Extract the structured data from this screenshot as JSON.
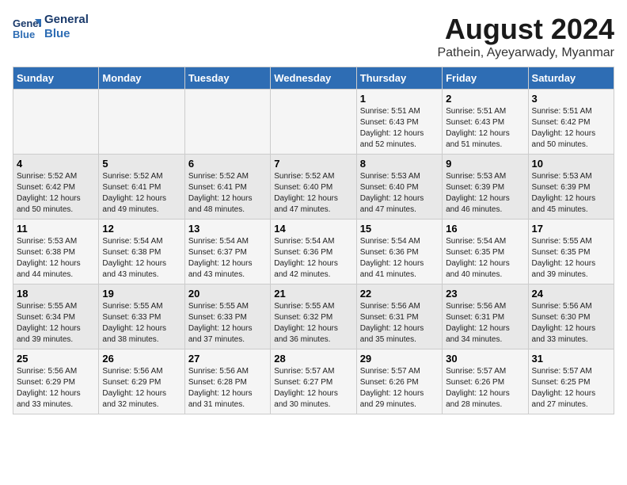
{
  "logo": {
    "line1": "General",
    "line2": "Blue"
  },
  "title": "August 2024",
  "subtitle": "Pathein, Ayeyarwady, Myanmar",
  "days_of_week": [
    "Sunday",
    "Monday",
    "Tuesday",
    "Wednesday",
    "Thursday",
    "Friday",
    "Saturday"
  ],
  "weeks": [
    [
      {
        "day": "",
        "info": ""
      },
      {
        "day": "",
        "info": ""
      },
      {
        "day": "",
        "info": ""
      },
      {
        "day": "",
        "info": ""
      },
      {
        "day": "1",
        "info": "Sunrise: 5:51 AM\nSunset: 6:43 PM\nDaylight: 12 hours\nand 52 minutes."
      },
      {
        "day": "2",
        "info": "Sunrise: 5:51 AM\nSunset: 6:43 PM\nDaylight: 12 hours\nand 51 minutes."
      },
      {
        "day": "3",
        "info": "Sunrise: 5:51 AM\nSunset: 6:42 PM\nDaylight: 12 hours\nand 50 minutes."
      }
    ],
    [
      {
        "day": "4",
        "info": "Sunrise: 5:52 AM\nSunset: 6:42 PM\nDaylight: 12 hours\nand 50 minutes."
      },
      {
        "day": "5",
        "info": "Sunrise: 5:52 AM\nSunset: 6:41 PM\nDaylight: 12 hours\nand 49 minutes."
      },
      {
        "day": "6",
        "info": "Sunrise: 5:52 AM\nSunset: 6:41 PM\nDaylight: 12 hours\nand 48 minutes."
      },
      {
        "day": "7",
        "info": "Sunrise: 5:52 AM\nSunset: 6:40 PM\nDaylight: 12 hours\nand 47 minutes."
      },
      {
        "day": "8",
        "info": "Sunrise: 5:53 AM\nSunset: 6:40 PM\nDaylight: 12 hours\nand 47 minutes."
      },
      {
        "day": "9",
        "info": "Sunrise: 5:53 AM\nSunset: 6:39 PM\nDaylight: 12 hours\nand 46 minutes."
      },
      {
        "day": "10",
        "info": "Sunrise: 5:53 AM\nSunset: 6:39 PM\nDaylight: 12 hours\nand 45 minutes."
      }
    ],
    [
      {
        "day": "11",
        "info": "Sunrise: 5:53 AM\nSunset: 6:38 PM\nDaylight: 12 hours\nand 44 minutes."
      },
      {
        "day": "12",
        "info": "Sunrise: 5:54 AM\nSunset: 6:38 PM\nDaylight: 12 hours\nand 43 minutes."
      },
      {
        "day": "13",
        "info": "Sunrise: 5:54 AM\nSunset: 6:37 PM\nDaylight: 12 hours\nand 43 minutes."
      },
      {
        "day": "14",
        "info": "Sunrise: 5:54 AM\nSunset: 6:36 PM\nDaylight: 12 hours\nand 42 minutes."
      },
      {
        "day": "15",
        "info": "Sunrise: 5:54 AM\nSunset: 6:36 PM\nDaylight: 12 hours\nand 41 minutes."
      },
      {
        "day": "16",
        "info": "Sunrise: 5:54 AM\nSunset: 6:35 PM\nDaylight: 12 hours\nand 40 minutes."
      },
      {
        "day": "17",
        "info": "Sunrise: 5:55 AM\nSunset: 6:35 PM\nDaylight: 12 hours\nand 39 minutes."
      }
    ],
    [
      {
        "day": "18",
        "info": "Sunrise: 5:55 AM\nSunset: 6:34 PM\nDaylight: 12 hours\nand 39 minutes."
      },
      {
        "day": "19",
        "info": "Sunrise: 5:55 AM\nSunset: 6:33 PM\nDaylight: 12 hours\nand 38 minutes."
      },
      {
        "day": "20",
        "info": "Sunrise: 5:55 AM\nSunset: 6:33 PM\nDaylight: 12 hours\nand 37 minutes."
      },
      {
        "day": "21",
        "info": "Sunrise: 5:55 AM\nSunset: 6:32 PM\nDaylight: 12 hours\nand 36 minutes."
      },
      {
        "day": "22",
        "info": "Sunrise: 5:56 AM\nSunset: 6:31 PM\nDaylight: 12 hours\nand 35 minutes."
      },
      {
        "day": "23",
        "info": "Sunrise: 5:56 AM\nSunset: 6:31 PM\nDaylight: 12 hours\nand 34 minutes."
      },
      {
        "day": "24",
        "info": "Sunrise: 5:56 AM\nSunset: 6:30 PM\nDaylight: 12 hours\nand 33 minutes."
      }
    ],
    [
      {
        "day": "25",
        "info": "Sunrise: 5:56 AM\nSunset: 6:29 PM\nDaylight: 12 hours\nand 33 minutes."
      },
      {
        "day": "26",
        "info": "Sunrise: 5:56 AM\nSunset: 6:29 PM\nDaylight: 12 hours\nand 32 minutes."
      },
      {
        "day": "27",
        "info": "Sunrise: 5:56 AM\nSunset: 6:28 PM\nDaylight: 12 hours\nand 31 minutes."
      },
      {
        "day": "28",
        "info": "Sunrise: 5:57 AM\nSunset: 6:27 PM\nDaylight: 12 hours\nand 30 minutes."
      },
      {
        "day": "29",
        "info": "Sunrise: 5:57 AM\nSunset: 6:26 PM\nDaylight: 12 hours\nand 29 minutes."
      },
      {
        "day": "30",
        "info": "Sunrise: 5:57 AM\nSunset: 6:26 PM\nDaylight: 12 hours\nand 28 minutes."
      },
      {
        "day": "31",
        "info": "Sunrise: 5:57 AM\nSunset: 6:25 PM\nDaylight: 12 hours\nand 27 minutes."
      }
    ]
  ]
}
